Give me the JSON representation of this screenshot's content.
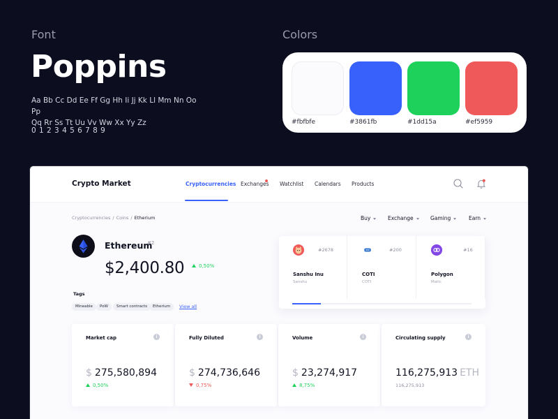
{
  "showcase": {
    "font_heading": "Font",
    "font_name": "Poppins",
    "alphabet_line1": "Aa Bb Cc Dd Ee Ff Gg Hh Ii Jj Kk Ll Mm Nn Oo Pp",
    "alphabet_line2": "Qq Rr Ss Tt Uu Vv Ww Xx Yy Zz",
    "numbers": "0 1 2 3 4 5 6 7 8 9",
    "colors_heading": "Colors",
    "swatches": [
      {
        "hex": "#fbfbfe",
        "label": "#fbfbfe"
      },
      {
        "hex": "#3861fb",
        "label": "#3861fb"
      },
      {
        "hex": "#1dd15a",
        "label": "#1dd15a"
      },
      {
        "hex": "#ef5959",
        "label": "#ef5959"
      }
    ]
  },
  "app": {
    "brand": "Crypto Market",
    "nav": [
      {
        "label": "Cryptocurrencies",
        "active": true
      },
      {
        "label": "Exchanges",
        "active": false,
        "badge": true
      },
      {
        "label": "Watchlist",
        "active": false
      },
      {
        "label": "Calendars",
        "active": false
      },
      {
        "label": "Products",
        "active": false
      }
    ],
    "icons": {
      "search": "search-icon",
      "bell": "bell-icon"
    },
    "breadcrumb": [
      "Cryptocurrencies",
      "Coins",
      "Etherium"
    ],
    "breadcrumb_sep": "/",
    "filters": [
      "Buy",
      "Exchange",
      "Gaming",
      "Earn"
    ],
    "coin": {
      "name": "Ethereum",
      "rank": "#2",
      "price": "$2,400.80",
      "change": "0,50%",
      "tags_label": "Tags",
      "tags": [
        "Mineable",
        "PoW",
        "Smart contracts",
        "Etherium"
      ],
      "view_all": "View all"
    },
    "trending": [
      {
        "name": "Sanshu Inu",
        "symbol": "Sanshu",
        "rank": "#2678",
        "color": "#ef5959"
      },
      {
        "name": "COTI",
        "symbol": "COTI",
        "rank": "#200",
        "color": "#1e66c8"
      },
      {
        "name": "Polygon",
        "symbol": "Matic",
        "rank": "#16",
        "color": "#8247e5"
      }
    ],
    "trending_progress": 0.16,
    "stats": [
      {
        "title": "Market cap",
        "currency": "$",
        "value": "275,580,894",
        "change": "0,50%",
        "direction": "up"
      },
      {
        "title": "Fully Diluted",
        "currency": "$",
        "value": "274,736,646",
        "change": "0,75%",
        "direction": "down"
      },
      {
        "title": "Volume",
        "currency": "$",
        "value": "23,274,917",
        "change": "8,75%",
        "direction": "up"
      },
      {
        "title": "Circulating supply",
        "value": "116,275,913",
        "unit": "ETH",
        "sub": "116,275,913"
      }
    ],
    "info_glyph": "i",
    "colors": {
      "accent": "#3861fb",
      "up": "#1dd15a",
      "down": "#ef5959",
      "background": "#fbfbfe"
    }
  }
}
